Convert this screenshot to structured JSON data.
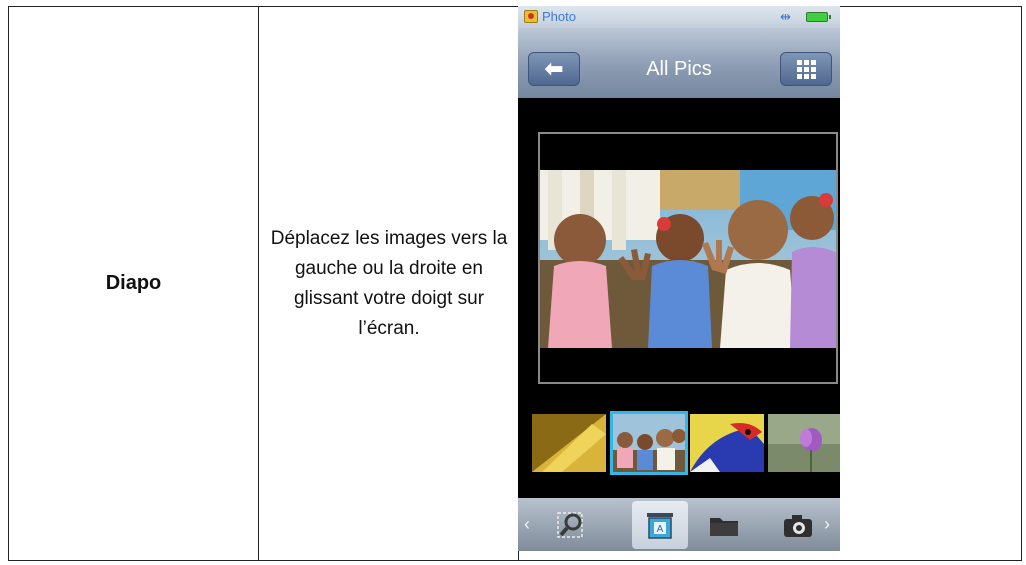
{
  "row": {
    "term": "Diapo",
    "description": "Déplacez les images vers la gauche ou la droite en glissant votre doigt sur l’écran."
  },
  "phone": {
    "status_bar": {
      "app_name": "Photo",
      "usb_icon": "usb-icon",
      "battery_icon": "battery-icon"
    },
    "nav_bar": {
      "title": "All Pics",
      "back_icon": "back-arrow-icon",
      "grid_icon": "grid-icon"
    },
    "main_photo": {
      "description_icon": "photo-of-children"
    },
    "thumbnails": [
      {
        "name": "thumbnail-yellow",
        "selected": false
      },
      {
        "name": "thumbnail-children",
        "selected": true
      },
      {
        "name": "thumbnail-parrot",
        "selected": false
      },
      {
        "name": "thumbnail-flower",
        "selected": false
      }
    ],
    "tab_bar": {
      "items": [
        {
          "name": "zoom-view-icon",
          "selected": false
        },
        {
          "name": "slideshow-icon",
          "selected": true
        },
        {
          "name": "folder-icon",
          "selected": false
        },
        {
          "name": "camera-icon",
          "selected": false
        }
      ],
      "chevron_left": "‹",
      "chevron_right": "›"
    },
    "colors": {
      "accent_blue": "#32b8e8",
      "app_name_blue": "#3a7ad8",
      "nav_gradient": "#8c9cb3",
      "battery_green": "#3fcf3f"
    }
  }
}
